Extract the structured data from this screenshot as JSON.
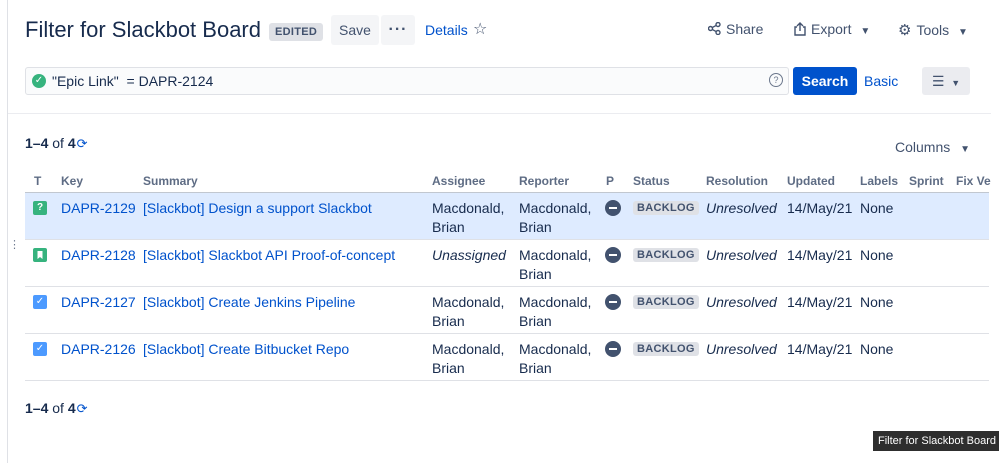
{
  "header": {
    "title": "Filter for Slackbot Board",
    "edited_label": "EDITED",
    "save_label": "Save",
    "more_label": "···",
    "details_label": "Details",
    "share_label": "Share",
    "export_label": "Export",
    "tools_label": "Tools"
  },
  "search": {
    "query": "\"Epic Link\"  = DAPR-2124",
    "search_label": "Search",
    "basic_label": "Basic"
  },
  "pagination": {
    "range": "1–4",
    "of": "of",
    "total": "4"
  },
  "columns_label": "Columns",
  "table": {
    "headers": [
      "T",
      "Key",
      "Summary",
      "Assignee",
      "Reporter",
      "P",
      "Status",
      "Resolution",
      "Updated",
      "Labels",
      "Sprint",
      "Fix Ve"
    ],
    "rows": [
      {
        "type": "question",
        "key": "DAPR-2129",
        "summary": "[Slackbot] Design a support Slackbot",
        "assignee": [
          "Macdonald,",
          "Brian"
        ],
        "reporter": [
          "Macdonald,",
          "Brian"
        ],
        "status": "BACKLOG",
        "resolution": "Unresolved",
        "updated": "14/May/21",
        "labels": "None"
      },
      {
        "type": "story",
        "key": "DAPR-2128",
        "summary": "[Slackbot] Slackbot API Proof-of-concept",
        "assignee": [
          "Unassigned",
          ""
        ],
        "reporter": [
          "Macdonald,",
          "Brian"
        ],
        "status": "BACKLOG",
        "resolution": "Unresolved",
        "updated": "14/May/21",
        "labels": "None"
      },
      {
        "type": "task",
        "key": "DAPR-2127",
        "summary": "[Slackbot] Create Jenkins Pipeline",
        "assignee": [
          "Macdonald,",
          "Brian"
        ],
        "reporter": [
          "Macdonald,",
          "Brian"
        ],
        "status": "BACKLOG",
        "resolution": "Unresolved",
        "updated": "14/May/21",
        "labels": "None"
      },
      {
        "type": "task",
        "key": "DAPR-2126",
        "summary": "[Slackbot] Create Bitbucket Repo",
        "assignee": [
          "Macdonald,",
          "Brian"
        ],
        "reporter": [
          "Macdonald,",
          "Brian"
        ],
        "status": "BACKLOG",
        "resolution": "Unresolved",
        "updated": "14/May/21",
        "labels": "None"
      }
    ]
  },
  "tooltip": "Filter for Slackbot Board",
  "colors": {
    "link": "#0052cc",
    "primary_button": "#0052cc",
    "selected_row": "#deebff",
    "question_icon": "#36b37e",
    "story_icon": "#36b37e",
    "task_icon": "#4c9aff"
  }
}
